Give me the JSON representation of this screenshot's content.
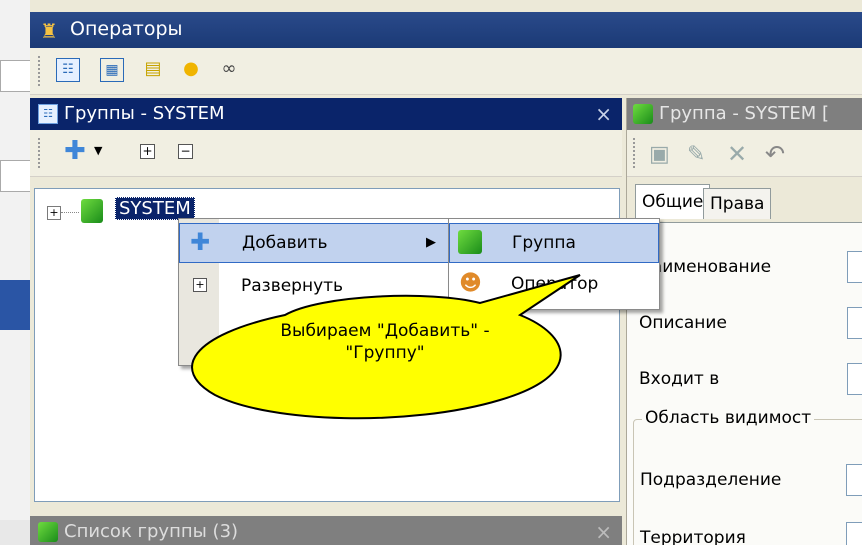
{
  "window": {
    "title": "Операторы"
  },
  "groups_panel": {
    "title": "Группы - SYSTEM",
    "tree_root": "SYSTEM",
    "close_glyph": "×"
  },
  "context_menu": {
    "items": [
      {
        "label": "Добавить",
        "icon": "plus-icon",
        "has_submenu": true
      },
      {
        "label": "Развернуть",
        "icon": "expand-icon"
      }
    ],
    "submenu": [
      {
        "label": "Группа",
        "icon": "group-add-icon"
      },
      {
        "label": "Оператор",
        "icon": "operator-icon"
      }
    ]
  },
  "callout": {
    "text": "Выбираем \"Добавить\" - \"Группу\""
  },
  "group_panel": {
    "title": "Группа - SYSTEM [",
    "tabs": [
      "Общие",
      "Права"
    ],
    "fields": [
      "Наименование",
      "Описание",
      "Входит в"
    ],
    "scope_group": {
      "legend": "Область видимост",
      "fields": [
        "Подразделение",
        "Территория"
      ]
    }
  },
  "list_panel": {
    "title": "Список группы (3)",
    "close_glyph": "×"
  },
  "colors": {
    "titlebar": "#1b3a76",
    "active_title": "#0a246a",
    "inactive_title": "#7f7f7f",
    "selection": "#316ac5",
    "callout": "#ffff00"
  }
}
